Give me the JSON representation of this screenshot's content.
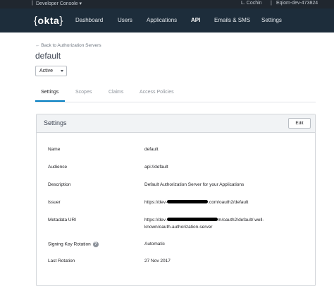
{
  "topbar": {
    "dev_console": "Developer Console",
    "user": "L. Cochin",
    "org": "Eqiom-dev-473824"
  },
  "nav": {
    "logo": "okta",
    "items": [
      "Dashboard",
      "Users",
      "Applications",
      "API",
      "Emails & SMS",
      "Settings"
    ],
    "active": "API"
  },
  "page": {
    "back_link": "← Back to Authorization Servers",
    "title": "default",
    "status_value": "Active"
  },
  "tabs": [
    "Settings",
    "Scopes",
    "Claims",
    "Access Policies"
  ],
  "panel": {
    "title": "Settings",
    "edit_label": "Edit",
    "fields": [
      {
        "label": "Name",
        "value": "default"
      },
      {
        "label": "Audience",
        "value": "api://default"
      },
      {
        "label": "Description",
        "value": "Default Authorization Server for your Applications"
      },
      {
        "label": "Issuer",
        "value_prefix": "https://dev-",
        "value_suffix": ".com/oauth2/default"
      },
      {
        "label": "Metadata URI",
        "value_prefix": "https://dev-",
        "value_suffix": "m/oauth2/default/.well-",
        "value_line2": "known/oauth-authorization-server"
      },
      {
        "label": "Signing Key Rotation",
        "value": "Automatic"
      },
      {
        "label": "Last Rotation",
        "value": "27 Nov 2017"
      }
    ]
  },
  "colors": {
    "topbar": "#20272f",
    "navbar": "#1d2d3b",
    "accent": "#007dc1"
  }
}
